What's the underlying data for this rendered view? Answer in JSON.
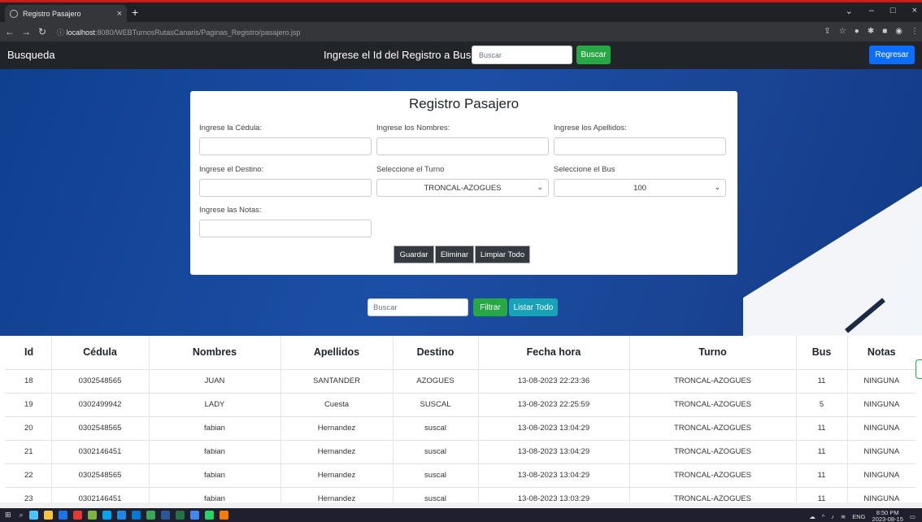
{
  "browser": {
    "tab_title": "Registro Pasajero",
    "tab_close": "×",
    "new_tab": "+",
    "url_host": "localhost",
    "url_rest": ":8080/WEBTurnosRutasCanaris/Paginas_Registro/pasajero.jsp",
    "win_min": "–",
    "win_max": "□",
    "win_close": "×"
  },
  "navbar": {
    "brand": "Busqueda",
    "search_label": "Ingrese el Id del Registro a Buscar",
    "search_placeholder": "Buscar",
    "search_button": "Buscar",
    "back_button": "Regresar"
  },
  "form": {
    "title": "Registro Pasajero",
    "cedula_label": "Ingrese la Cédula:",
    "nombres_label": "Ingrese los Nombres:",
    "apellidos_label": "Ingrese los Apellidos:",
    "destino_label": "Ingrese el Destino:",
    "turno_label": "Seleccione el Turno",
    "turno_value": "TRONCAL-AZOGUES",
    "bus_label": "Seleccione el Bus",
    "bus_value": "100",
    "notas_label": "Ingrese las Notas:",
    "guardar": "Guardar",
    "eliminar": "Eliminar",
    "limpiar": "Limpiar Todo"
  },
  "filter": {
    "placeholder": "Buscar",
    "filtrar": "Filtrar",
    "listar": "Listar Todo"
  },
  "table": {
    "headers": [
      "Id",
      "Cédula",
      "Nombres",
      "Apellidos",
      "Destino",
      "Fecha hora",
      "Turno",
      "Bus",
      "Notas"
    ],
    "rows": [
      [
        "18",
        "0302548565",
        "JUAN",
        "SANTANDER",
        "AZOGUES",
        "13-08-2023 22:23:36",
        "TRONCAL-AZOGUES",
        "11",
        "NINGUNA"
      ],
      [
        "19",
        "0302499942",
        "LADY",
        "Cuesta",
        "SUSCAL",
        "13-08-2023 22:25:59",
        "TRONCAL-AZOGUES",
        "5",
        "NINGUNA"
      ],
      [
        "20",
        "0302548565",
        "fabian",
        "Hernandez",
        "suscal",
        "13-08-2023 13:04:29",
        "TRONCAL-AZOGUES",
        "11",
        "NINGUNA"
      ],
      [
        "21",
        "0302146451",
        "fabian",
        "Hernandez",
        "suscal",
        "13-08-2023 13:04:29",
        "TRONCAL-AZOGUES",
        "11",
        "NINGUNA"
      ],
      [
        "22",
        "0302548565",
        "fabian",
        "Hernandez",
        "suscal",
        "13-08-2023 13:04:29",
        "TRONCAL-AZOGUES",
        "11",
        "NINGUNA"
      ],
      [
        "23",
        "0302146451",
        "fabian",
        "Hernandez",
        "suscal",
        "13-08-2023 13:03:29",
        "TRONCAL-AZOGUES",
        "11",
        "NINGUNA"
      ]
    ]
  },
  "taskbar": {
    "lang": "ENG",
    "time": "8:50 PM",
    "date": "2023-08-15",
    "icon_colors": [
      "#4cc2ff",
      "#f4c542",
      "#1a73e8",
      "#e53935",
      "#7cb342",
      "#00a4ef",
      "#1e88e5",
      "#0078d4",
      "#3aa757",
      "#2b579a",
      "#217346",
      "#4285f4",
      "#25d366",
      "#ff7a00"
    ]
  },
  "colors": {
    "navbar": "#212529",
    "hero": "#1b4fa6",
    "success": "#28a745",
    "primary": "#0d6efd",
    "info": "#17a2b8",
    "dark": "#343a40"
  }
}
